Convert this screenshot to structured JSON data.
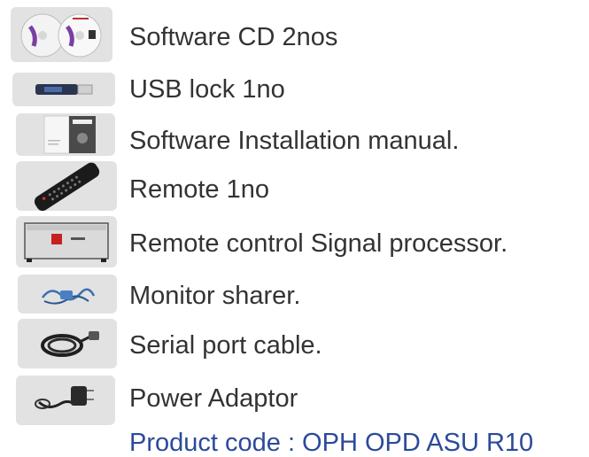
{
  "items": [
    {
      "label": "Software CD  2nos",
      "icon": "software-cd-icon"
    },
    {
      "label": "USB lock  1no",
      "icon": "usb-lock-icon"
    },
    {
      "label": "Software Installation manual.",
      "icon": "manual-icon"
    },
    {
      "label": "Remote  1no",
      "icon": "remote-icon"
    },
    {
      "label": "Remote control Signal processor.",
      "icon": "signal-processor-icon"
    },
    {
      "label": "Monitor sharer.",
      "icon": "monitor-sharer-icon"
    },
    {
      "label": "Serial port cable.",
      "icon": "serial-cable-icon"
    },
    {
      "label": "Power Adaptor",
      "icon": "power-adaptor-icon"
    }
  ],
  "product_code": "Product code : OPH OPD ASU R10",
  "colors": {
    "text": "#333333",
    "product_code": "#2b4a9a",
    "thumb_bg": "#e2e2e2"
  }
}
